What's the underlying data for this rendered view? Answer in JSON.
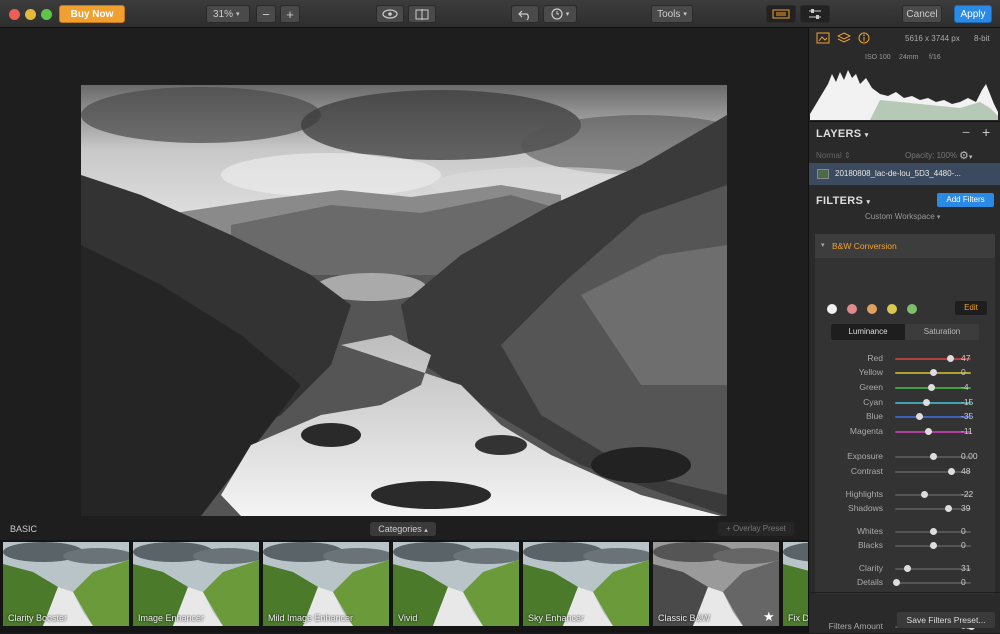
{
  "toolbar": {
    "buy_now": "Buy Now",
    "zoom": "31%",
    "zoom_out": "−",
    "zoom_in": "+",
    "tools": "Tools",
    "cancel": "Cancel",
    "apply": "Apply",
    "colors": {
      "buy": "#f0a030",
      "apply": "#2a8ae6",
      "close": "#ec5f57",
      "min": "#e4b83a",
      "max": "#5ec548"
    }
  },
  "canvas": {
    "section": "BASIC",
    "categories": "Categories",
    "overlay_preset": "+ Overlay Preset"
  },
  "presets": [
    {
      "label": "Clarity Booster",
      "bw": false
    },
    {
      "label": "Image Enhancer",
      "bw": false
    },
    {
      "label": "Mild Image Enhancer",
      "bw": false
    },
    {
      "label": "Vivid",
      "bw": false
    },
    {
      "label": "Sky Enhancer",
      "bw": false
    },
    {
      "label": "Classic B&W",
      "bw": true
    },
    {
      "label": "Fix D",
      "bw": false
    }
  ],
  "info": {
    "dimensions": "5616 x 3744 px",
    "bit_depth": "8-bit",
    "iso": "ISO 100",
    "focal": "24mm",
    "aperture": "f/16"
  },
  "layers": {
    "title": "LAYERS",
    "blend": "Normal",
    "opacity": "Opacity: 100%",
    "layer_name": "20180808_lac-de-lou_5D3_4480-..."
  },
  "filters": {
    "title": "FILTERS",
    "add": "Add Filters",
    "workspace": "Custom Workspace",
    "bw_title": "B&W Conversion",
    "edit": "Edit",
    "tab_luminance": "Luminance",
    "tab_saturation": "Saturation",
    "color_dots": [
      "#f2f2f2",
      "#e08b8b",
      "#e0a060",
      "#d9c850",
      "#7ec06a"
    ],
    "color_sliders": [
      {
        "name": "Red",
        "value": "47",
        "pos": 0.73,
        "color": "#b34040"
      },
      {
        "name": "Yellow",
        "value": "0",
        "pos": 0.5,
        "color": "#b0a030"
      },
      {
        "name": "Green",
        "value": "-4",
        "pos": 0.48,
        "color": "#40a040"
      },
      {
        "name": "Cyan",
        "value": "-15",
        "pos": 0.42,
        "color": "#40a0b0"
      },
      {
        "name": "Blue",
        "value": "-35",
        "pos": 0.32,
        "color": "#4060c0"
      },
      {
        "name": "Magenta",
        "value": "-11",
        "pos": 0.44,
        "color": "#b040a0"
      }
    ],
    "tone_sliders": [
      {
        "name": "Exposure",
        "value": "0.00",
        "pos": 0.5
      },
      {
        "name": "Contrast",
        "value": "48",
        "pos": 0.74
      },
      {
        "name": "Highlights",
        "value": "-22",
        "pos": 0.39
      },
      {
        "name": "Shadows",
        "value": "39",
        "pos": 0.7
      },
      {
        "name": "Whites",
        "value": "0",
        "pos": 0.5
      },
      {
        "name": "Blacks",
        "value": "0",
        "pos": 0.5
      },
      {
        "name": "Clarity",
        "value": "31",
        "pos": 0.16
      },
      {
        "name": "Details",
        "value": "0",
        "pos": 0.02
      }
    ],
    "amount_label": "Filters Amount",
    "amount_value": "100",
    "amount_pos": 1.0,
    "save_preset": "Save Filters Preset..."
  }
}
